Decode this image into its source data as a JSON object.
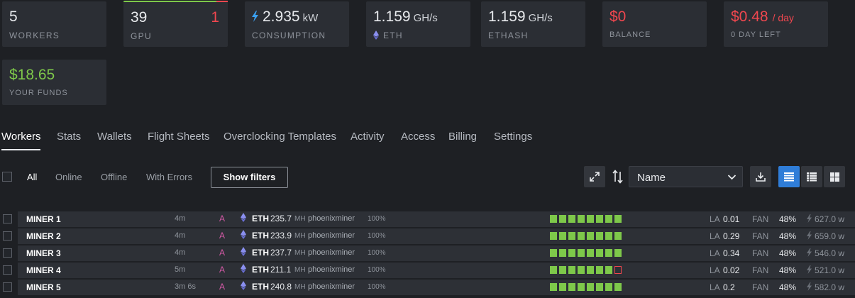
{
  "stats": {
    "workers": {
      "value": "5",
      "label": "WORKERS"
    },
    "gpu": {
      "value": "39",
      "errors": "1",
      "label": "GPU"
    },
    "consumption": {
      "value": "2.935",
      "unit": "kW",
      "label": "CONSUMPTION"
    },
    "eth_hashrate": {
      "value": "1.159",
      "unit": "GH/s",
      "label": "ETH"
    },
    "ethash_hashrate": {
      "value": "1.159",
      "unit": "GH/s",
      "label": "ETHASH"
    },
    "balance": {
      "value": "$0",
      "label": "BALANCE"
    },
    "cost": {
      "value": "$0.48",
      "per": "/ day",
      "label": "0 DAY LEFT"
    },
    "funds": {
      "value": "$18.65",
      "label": "YOUR FUNDS"
    }
  },
  "tabs": [
    "Workers",
    "Stats",
    "Wallets",
    "Flight Sheets",
    "Overclocking Templates",
    "Activity",
    "Access",
    "Billing",
    "Settings"
  ],
  "filters": {
    "items": [
      "All",
      "Online",
      "Offline",
      "With Errors"
    ],
    "show_filters_label": "Show filters",
    "sort_value": "Name"
  },
  "workers": [
    {
      "name": "MINER 1",
      "uptime": "4m",
      "mark": "A",
      "coin": "ETH",
      "hashrate": "235.7",
      "unit": "MH",
      "miner": "phoenixminer",
      "pct": "100%",
      "gpu_ok": 8,
      "gpu_bad": 0,
      "la_label": "LA",
      "la": "0.01",
      "fan_label": "FAN",
      "fan": "48%",
      "power": "627.0 w"
    },
    {
      "name": "MINER 2",
      "uptime": "4m",
      "mark": "A",
      "coin": "ETH",
      "hashrate": "233.9",
      "unit": "MH",
      "miner": "phoenixminer",
      "pct": "100%",
      "gpu_ok": 8,
      "gpu_bad": 0,
      "la_label": "LA",
      "la": "0.29",
      "fan_label": "FAN",
      "fan": "48%",
      "power": "659.0 w"
    },
    {
      "name": "MINER 3",
      "uptime": "4m",
      "mark": "A",
      "coin": "ETH",
      "hashrate": "237.7",
      "unit": "MH",
      "miner": "phoenixminer",
      "pct": "100%",
      "gpu_ok": 8,
      "gpu_bad": 0,
      "la_label": "LA",
      "la": "0.34",
      "fan_label": "FAN",
      "fan": "48%",
      "power": "546.0 w"
    },
    {
      "name": "MINER 4",
      "uptime": "5m",
      "mark": "A",
      "coin": "ETH",
      "hashrate": "211.1",
      "unit": "MH",
      "miner": "phoenixminer",
      "pct": "100%",
      "gpu_ok": 7,
      "gpu_bad": 1,
      "la_label": "LA",
      "la": "0.02",
      "fan_label": "FAN",
      "fan": "48%",
      "power": "521.0 w"
    },
    {
      "name": "MINER 5",
      "uptime": "3m 6s",
      "mark": "A",
      "coin": "ETH",
      "hashrate": "240.8",
      "unit": "MH",
      "miner": "phoenixminer",
      "pct": "100%",
      "gpu_ok": 8,
      "gpu_bad": 0,
      "la_label": "LA",
      "la": "0.2",
      "fan_label": "FAN",
      "fan": "48%",
      "power": "582.0 w"
    }
  ],
  "colors": {
    "accent_green": "#7ec84a",
    "accent_red": "#f0474f",
    "accent_blue": "#2f7dd8",
    "pool_mark": "#d65aa8"
  }
}
